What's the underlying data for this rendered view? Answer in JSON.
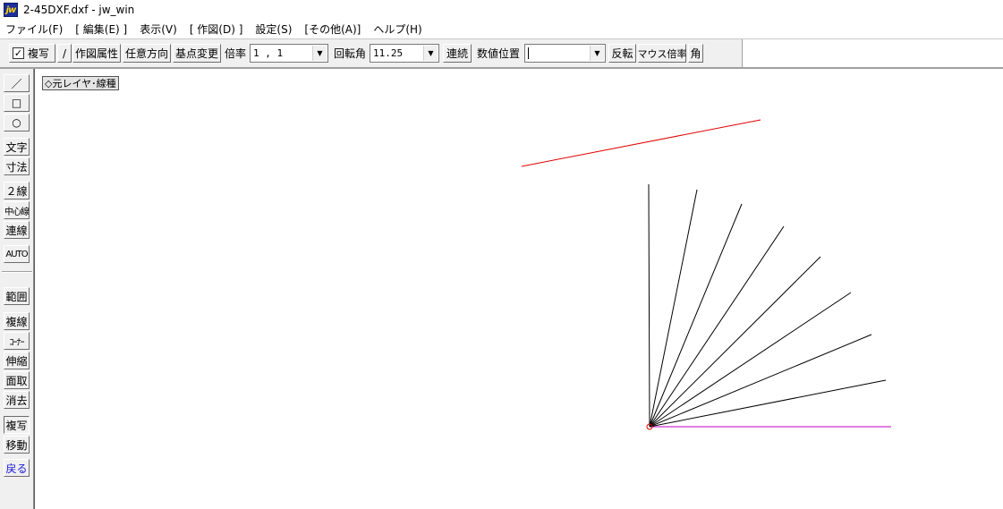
{
  "window": {
    "title": "2-45DXF.dxf - jw_win",
    "app_icon_text": "jw"
  },
  "menu": [
    {
      "id": "file",
      "label": "ファイル(F)"
    },
    {
      "id": "edit",
      "label": "[ 編集(E) ]"
    },
    {
      "id": "view",
      "label": "表示(V)"
    },
    {
      "id": "draw",
      "label": "[ 作図(D) ]"
    },
    {
      "id": "settings",
      "label": "設定(S)"
    },
    {
      "id": "other",
      "label": "[その他(A)]"
    },
    {
      "id": "help",
      "label": "ヘルプ(H)"
    }
  ],
  "toolbar": {
    "copy_checkbox": {
      "label": "複写",
      "checked": true,
      "mark": "✓"
    },
    "slash_btn": "/",
    "attr_btn": "作図属性",
    "direction_btn": "任意方向",
    "basepoint_btn": "基点変更",
    "scale_label": "倍率",
    "scale_value": "1 , 1",
    "rotation_label": "回転角",
    "rotation_value": "11.25",
    "continuous_btn": "連続",
    "numpos_label": "数値位置",
    "numpos_value": "",
    "flip_btn": "反転",
    "mouse_scale_btn": "マウス倍率",
    "angle_btn": "角"
  },
  "left_tools": {
    "line": "／",
    "rect": "□",
    "circle": "○",
    "text": "文字",
    "dimension": "寸法",
    "double_line": "２線",
    "center_line": "中心線",
    "connected_line": "連線",
    "auto": "AUTO",
    "range": "範囲",
    "multi_line": "複線",
    "corner": "ｺｰﾅｰ",
    "stretch": "伸縮",
    "chamfer": "面取",
    "erase": "消去",
    "copy": "複写",
    "move": "移動",
    "undo": "戻る"
  },
  "canvas": {
    "layer_label": "◇元レイヤ･線種",
    "colors": {
      "red_line": "#e00000",
      "black_line": "#000000",
      "magenta_line": "#c000c0"
    }
  }
}
